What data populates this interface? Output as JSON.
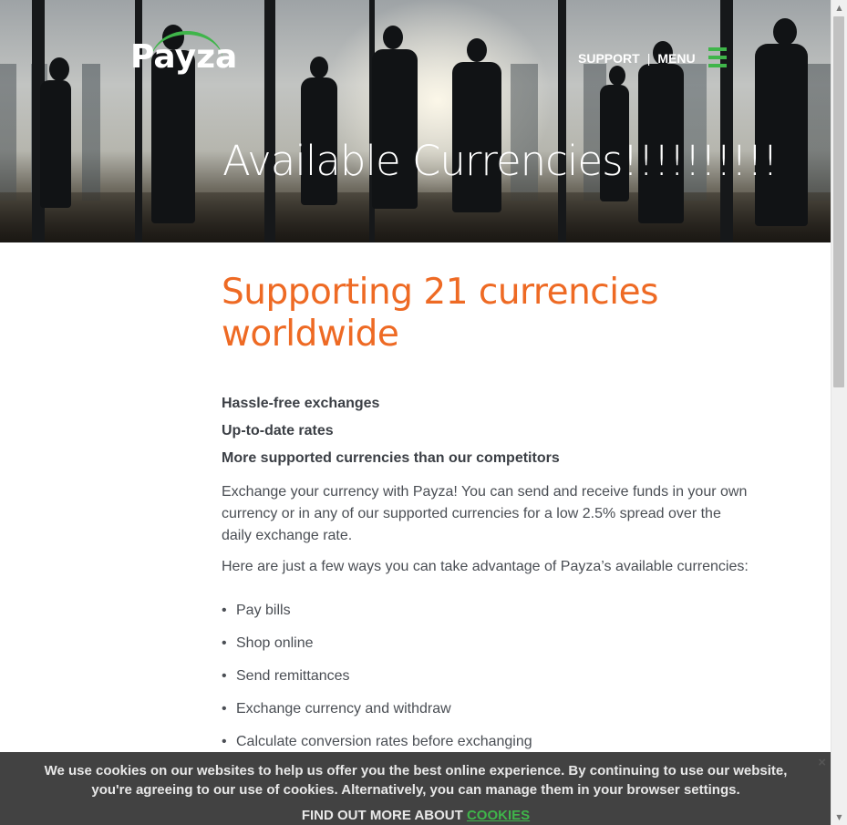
{
  "brand": {
    "name": "Payza",
    "accent": "#3fb54a",
    "headline_color": "#ee6a24"
  },
  "nav": {
    "support": "SUPPORT",
    "separator": "|",
    "menu": "MENU",
    "menu_icon": "hamburger-icon"
  },
  "hero": {
    "title": "Available Currencies!!!!!!!!!!"
  },
  "main": {
    "headline": "Supporting 21 currencies worldwide",
    "features": [
      "Hassle-free exchanges",
      "Up-to-date rates",
      "More supported currencies than our competitors"
    ],
    "paragraph1": "Exchange your currency with Payza! You can send and receive funds in your own currency or in any of our supported currencies for a low 2.5% spread over the daily exchange rate.",
    "paragraph2": "Here are just a few ways you can take advantage of Payza’s available currencies:",
    "bullet": "•",
    "uses": [
      "Pay bills",
      "Shop online",
      "Send remittances",
      "Exchange currency and withdraw",
      "Calculate conversion rates before exchanging"
    ]
  },
  "cookie": {
    "message": "We use cookies on our websites to help us offer you the best online experience. By continuing to use our website, you're agreeing to our use of cookies. Alternatively, you can manage them in your browser settings.",
    "find_out": "FIND OUT MORE ABOUT",
    "link": "COOKIES",
    "close": "×"
  },
  "scrollbar": {
    "up": "▲",
    "down": "▼"
  }
}
